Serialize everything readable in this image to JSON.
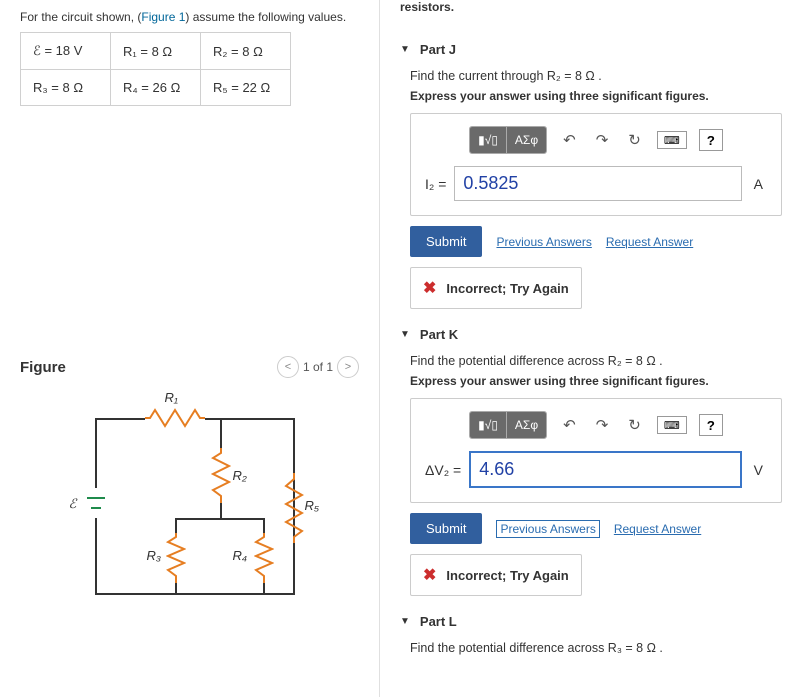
{
  "intro_prefix": "For the circuit shown, (",
  "intro_link": "Figure 1",
  "intro_suffix": ") assume the following values.",
  "values": {
    "r1c1": "ℰ = 18 V",
    "r1c2": "R₁ = 8 Ω",
    "r1c3": "R₂ = 8 Ω",
    "r2c1": "R₃ = 8 Ω",
    "r2c2": "R₄ = 26 Ω",
    "r2c3": "R₅ = 22 Ω"
  },
  "figure": {
    "title": "Figure",
    "page": "1 of 1",
    "labels": {
      "emf": "ℰ",
      "r1": "R₁",
      "r2": "R₂",
      "r3": "R₃",
      "r4": "R₄",
      "r5": "R₅"
    }
  },
  "top_text": "resistors.",
  "toolbar": {
    "sigma": "ΑΣφ",
    "undo": "↶",
    "redo": "↷",
    "reset": "↻",
    "help": "?"
  },
  "common": {
    "submit": "Submit",
    "prev": "Previous Answers",
    "req": "Request Answer",
    "feedback": "Incorrect; Try Again"
  },
  "partJ": {
    "title": "Part J",
    "prompt": "Find the current through R₂ = 8 Ω .",
    "instruct": "Express your answer using three significant figures.",
    "lhs": "I₂ =",
    "value": "0.5825",
    "unit": "A"
  },
  "partK": {
    "title": "Part K",
    "prompt": "Find the potential difference across R₂ = 8 Ω .",
    "instruct": "Express your answer using three significant figures.",
    "lhs": "ΔV₂ =",
    "value": "4.66",
    "unit": "V"
  },
  "partL": {
    "title": "Part L",
    "prompt": "Find the potential difference across R₃ = 8 Ω ."
  }
}
